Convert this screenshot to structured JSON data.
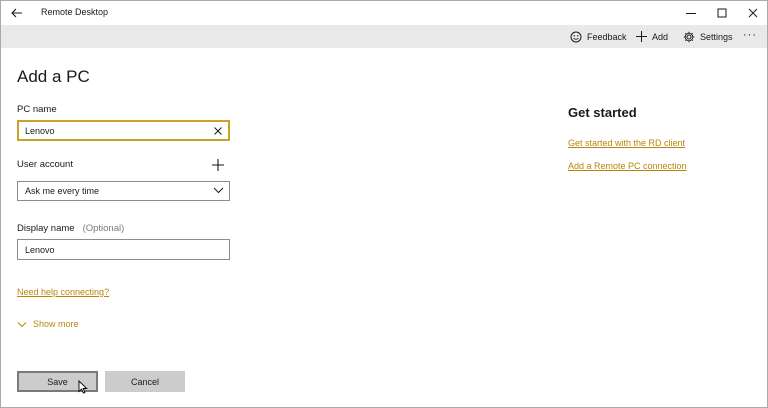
{
  "window": {
    "title": "Remote Desktop"
  },
  "icons": {
    "back": "arrow-left-icon",
    "minimize": "minimize-icon",
    "maximize": "maximize-icon",
    "close": "close-icon",
    "feedback": "smiley-icon",
    "add": "plus-icon",
    "settings": "gear-icon",
    "more": "ellipsis-icon",
    "clear": "clear-x-icon",
    "dropdown": "chevron-down-icon",
    "show_more": "chevron-down-icon",
    "add_account": "plus-icon"
  },
  "commandbar": {
    "feedback_label": "Feedback",
    "add_label": "Add",
    "settings_label": "Settings",
    "more_label": "···"
  },
  "form": {
    "title": "Add a PC",
    "pc_name": {
      "label": "PC name",
      "value": "Lenovo"
    },
    "user_account": {
      "label": "User account",
      "selected": "Ask me every time"
    },
    "display_name": {
      "label": "Display name",
      "optional": "(Optional)",
      "value": "Lenovo"
    },
    "help_link": "Need help connecting?",
    "show_more": "Show more",
    "save_label": "Save",
    "cancel_label": "Cancel"
  },
  "get_started": {
    "title": "Get started",
    "links": [
      "Get started with the RD client",
      "Add a Remote PC connection"
    ]
  },
  "colors": {
    "accent": "#c9a227",
    "link": "#b8860b",
    "commandbar_bg": "#e9e9e9",
    "button_bg": "#cccccc"
  }
}
